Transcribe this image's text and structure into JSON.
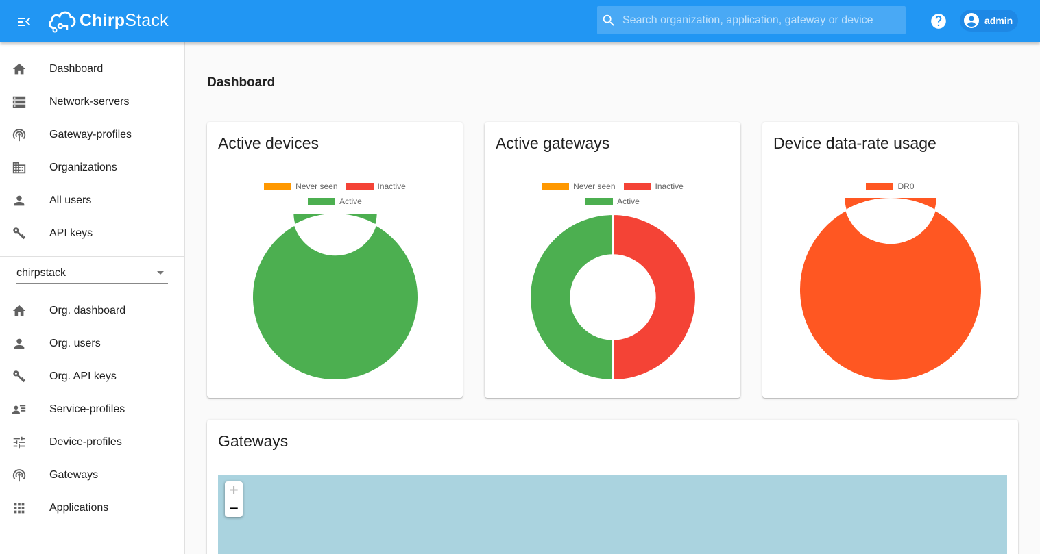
{
  "header": {
    "logo_text_bold": "Chirp",
    "logo_text_light": "Stack",
    "search_placeholder": "Search organization, application, gateway or device",
    "username": "admin"
  },
  "sidebar": {
    "admin_items": [
      {
        "label": "Dashboard",
        "icon": "home-icon"
      },
      {
        "label": "Network-servers",
        "icon": "server-icon"
      },
      {
        "label": "Gateway-profiles",
        "icon": "antenna-icon"
      },
      {
        "label": "Organizations",
        "icon": "building-icon"
      },
      {
        "label": "All users",
        "icon": "person-icon"
      },
      {
        "label": "API keys",
        "icon": "key-icon"
      }
    ],
    "org_selected": "chirpstack",
    "org_items": [
      {
        "label": "Org. dashboard",
        "icon": "home-icon"
      },
      {
        "label": "Org. users",
        "icon": "person-icon"
      },
      {
        "label": "Org. API keys",
        "icon": "key-icon"
      },
      {
        "label": "Service-profiles",
        "icon": "account-details-icon"
      },
      {
        "label": "Device-profiles",
        "icon": "tune-icon"
      },
      {
        "label": "Gateways",
        "icon": "antenna-icon"
      },
      {
        "label": "Applications",
        "icon": "apps-grid-icon"
      }
    ]
  },
  "main": {
    "page_title": "Dashboard",
    "gateways_card_title": "Gateways",
    "map_zoom_in": "+",
    "map_zoom_out": "−"
  },
  "colors": {
    "never_seen": "#ff9800",
    "inactive": "#f44336",
    "active": "#4caf50",
    "dr0": "#ff5722"
  },
  "chart_data": [
    {
      "type": "pie",
      "title": "Active devices",
      "legend": [
        "Never seen",
        "Inactive",
        "Active"
      ],
      "values": [
        0,
        0,
        1
      ],
      "colors": [
        "#ff9800",
        "#f44336",
        "#4caf50"
      ]
    },
    {
      "type": "pie",
      "title": "Active gateways",
      "legend": [
        "Never seen",
        "Inactive",
        "Active"
      ],
      "values": [
        0,
        1,
        1
      ],
      "colors": [
        "#ff9800",
        "#f44336",
        "#4caf50"
      ]
    },
    {
      "type": "pie",
      "title": "Device data-rate usage",
      "legend": [
        "DR0"
      ],
      "values": [
        1
      ],
      "colors": [
        "#ff5722"
      ]
    }
  ]
}
